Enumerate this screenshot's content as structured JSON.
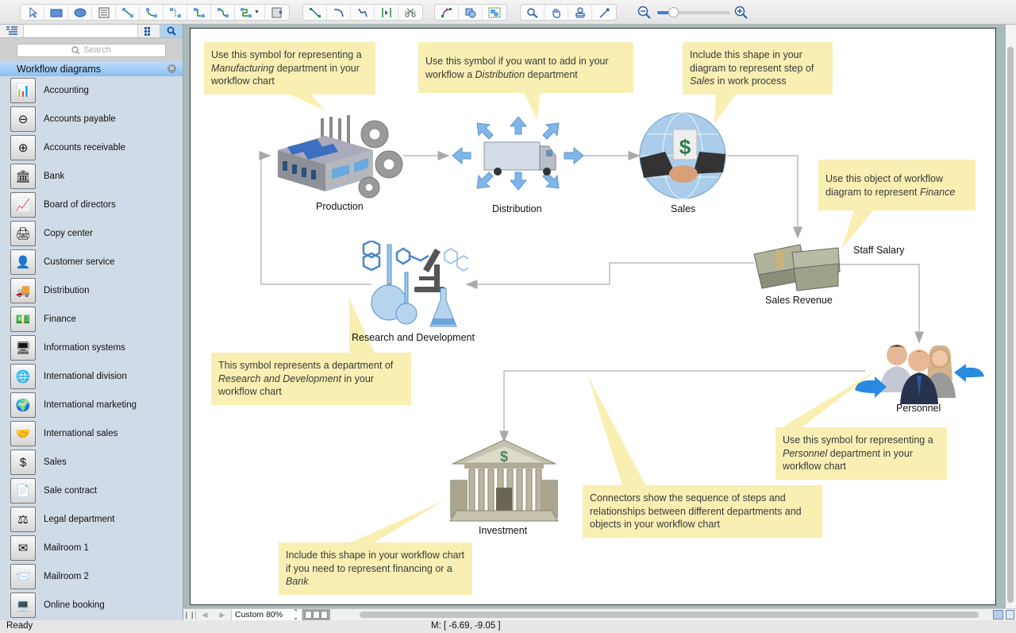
{
  "toolbar": {
    "groups": [
      [
        "pointer-tool",
        "rectangle-tool",
        "ellipse-tool",
        "text-tool",
        "direct-connector-tool",
        "arc-connector-tool",
        "bezier-connector-tool",
        "smart-connector-tool",
        "round-connector-tool",
        "tree-connector-tool",
        "insert-container-tool"
      ],
      [
        "line-tool",
        "arc-tool",
        "polyline-tool",
        "split-tool",
        "scissors-tool"
      ],
      [
        "edit-points-tool",
        "union-tool",
        "group-tool"
      ],
      [
        "zoom-tool",
        "pan-tool",
        "stamp-tool",
        "eyedropper-tool"
      ]
    ],
    "zoom_level_percent": 22
  },
  "sidebar": {
    "search_placeholder": "Search",
    "library_title": "Workflow diagrams",
    "items": [
      {
        "label": "Accounting",
        "icon": "📊"
      },
      {
        "label": "Accounts payable",
        "icon": "⊖"
      },
      {
        "label": "Accounts receivable",
        "icon": "⊕"
      },
      {
        "label": "Bank",
        "icon": "🏛"
      },
      {
        "label": "Board of directors",
        "icon": "📈"
      },
      {
        "label": "Copy center",
        "icon": "🖨"
      },
      {
        "label": "Customer service",
        "icon": "👤"
      },
      {
        "label": "Distribution",
        "icon": "🚚"
      },
      {
        "label": "Finance",
        "icon": "💵"
      },
      {
        "label": "Information systems",
        "icon": "🖥"
      },
      {
        "label": "International division",
        "icon": "🌐"
      },
      {
        "label": "International marketing",
        "icon": "🌍"
      },
      {
        "label": "International sales",
        "icon": "🤝"
      },
      {
        "label": "Sales",
        "icon": "$"
      },
      {
        "label": "Sale contract",
        "icon": "📄"
      },
      {
        "label": "Legal department",
        "icon": "⚖"
      },
      {
        "label": "Mailroom 1",
        "icon": "✉"
      },
      {
        "label": "Mailroom 2",
        "icon": "📨"
      },
      {
        "label": "Online booking",
        "icon": "💻"
      }
    ]
  },
  "diagram": {
    "nodes": {
      "production": "Production",
      "distribution": "Distribution",
      "sales": "Sales",
      "staff_salary": "Staff Salary",
      "sales_revenue": "Sales Revenue",
      "research": "Research and Development",
      "personnel": "Personnel",
      "investment": "Investment"
    },
    "callouts": {
      "production": {
        "a": "Use this symbol for representing a ",
        "em": "Manufacturing",
        "b": " department in your workflow chart"
      },
      "distribution": {
        "a": "Use this symbol if you want to add in your workflow a ",
        "em": "Distribution",
        "b": " department"
      },
      "sales": {
        "a": "Include this shape in your diagram to represent step of ",
        "em": "Sales",
        "b": " in work process"
      },
      "finance": {
        "a": "Use this object of workflow diagram to represent ",
        "em": "Finance",
        "b": ""
      },
      "research": {
        "a": "This symbol represents a department of ",
        "em": "Research and Development",
        "b": " in your workflow chart"
      },
      "personnel": {
        "a": "Use this symbol for representing a ",
        "em": "Personnel",
        "b": " department in your workflow chart"
      },
      "connectors": {
        "a": "Connectors show the sequence of steps and relationships between different departments and objects in your workflow chart",
        "em": "",
        "b": ""
      },
      "investment": {
        "a": "Include this shape in your workflow chart if you need to represent financing or a ",
        "em": "Bank",
        "b": ""
      }
    }
  },
  "bottombar": {
    "zoom_label": "Custom 80%"
  },
  "status": {
    "left": "Ready",
    "coords": "M: [ -6.69, -9.05 ]"
  }
}
